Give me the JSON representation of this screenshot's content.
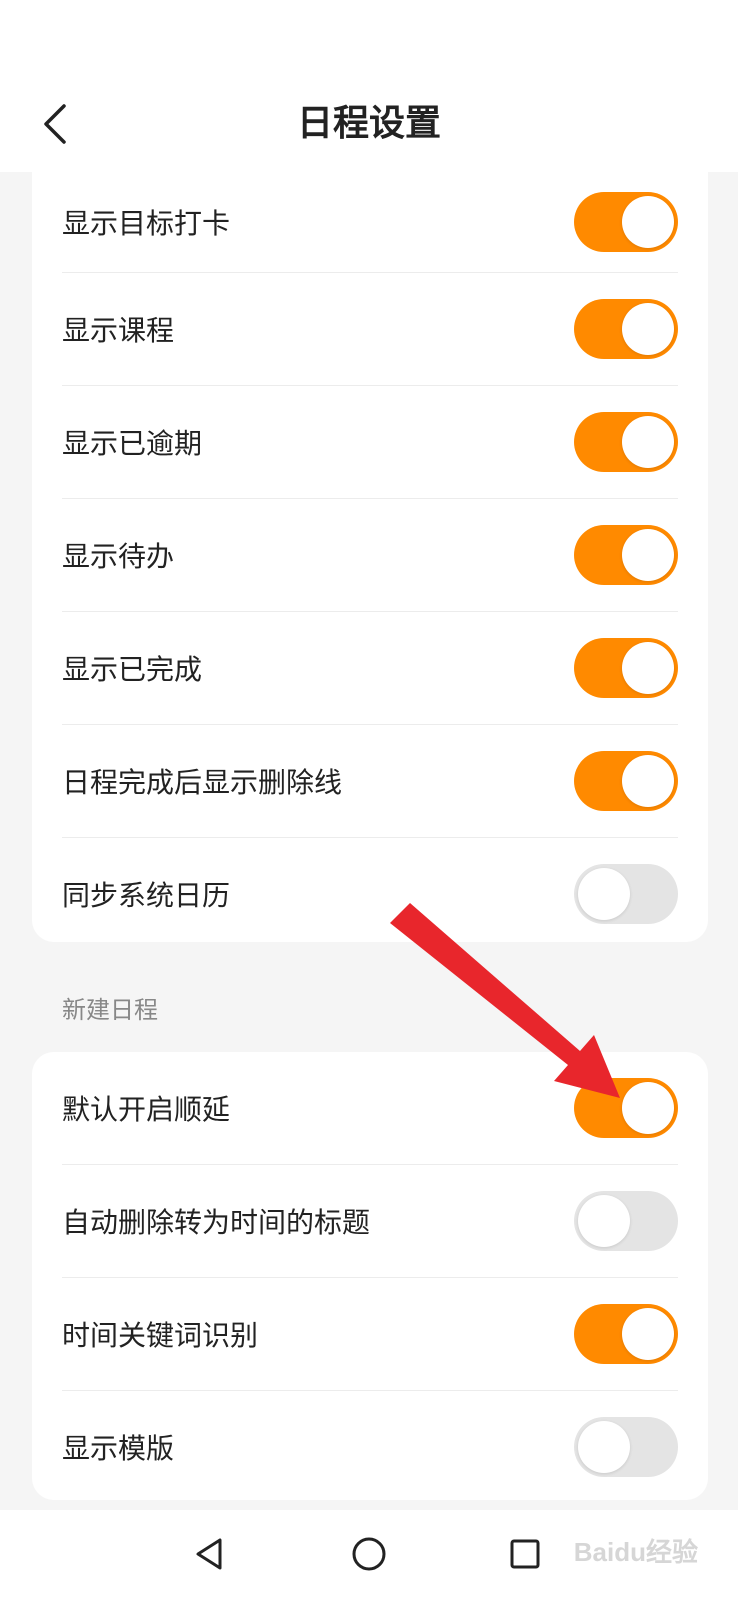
{
  "header": {
    "title": "日程设置"
  },
  "display_settings": [
    {
      "label": "显示目标打卡",
      "on": true
    },
    {
      "label": "显示课程",
      "on": true
    },
    {
      "label": "显示已逾期",
      "on": true
    },
    {
      "label": "显示待办",
      "on": true
    },
    {
      "label": "显示已完成",
      "on": true
    },
    {
      "label": "日程完成后显示删除线",
      "on": true
    },
    {
      "label": "同步系统日历",
      "on": false
    }
  ],
  "new_schedule": {
    "section_title": "新建日程",
    "items": [
      {
        "label": "默认开启顺延",
        "on": true
      },
      {
        "label": "自动删除转为时间的标题",
        "on": false
      },
      {
        "label": "时间关键词识别",
        "on": true
      },
      {
        "label": "显示模版",
        "on": false
      }
    ]
  },
  "colors": {
    "toggle_on": "#ff8a00",
    "toggle_off": "#e4e4e4",
    "annotation_arrow": "#e8262c"
  },
  "watermark": "Baidu经验",
  "icons": {
    "back": "chevron-left-icon",
    "nav_back": "triangle-back-icon",
    "nav_home": "circle-home-icon",
    "nav_recents": "square-recents-icon"
  }
}
